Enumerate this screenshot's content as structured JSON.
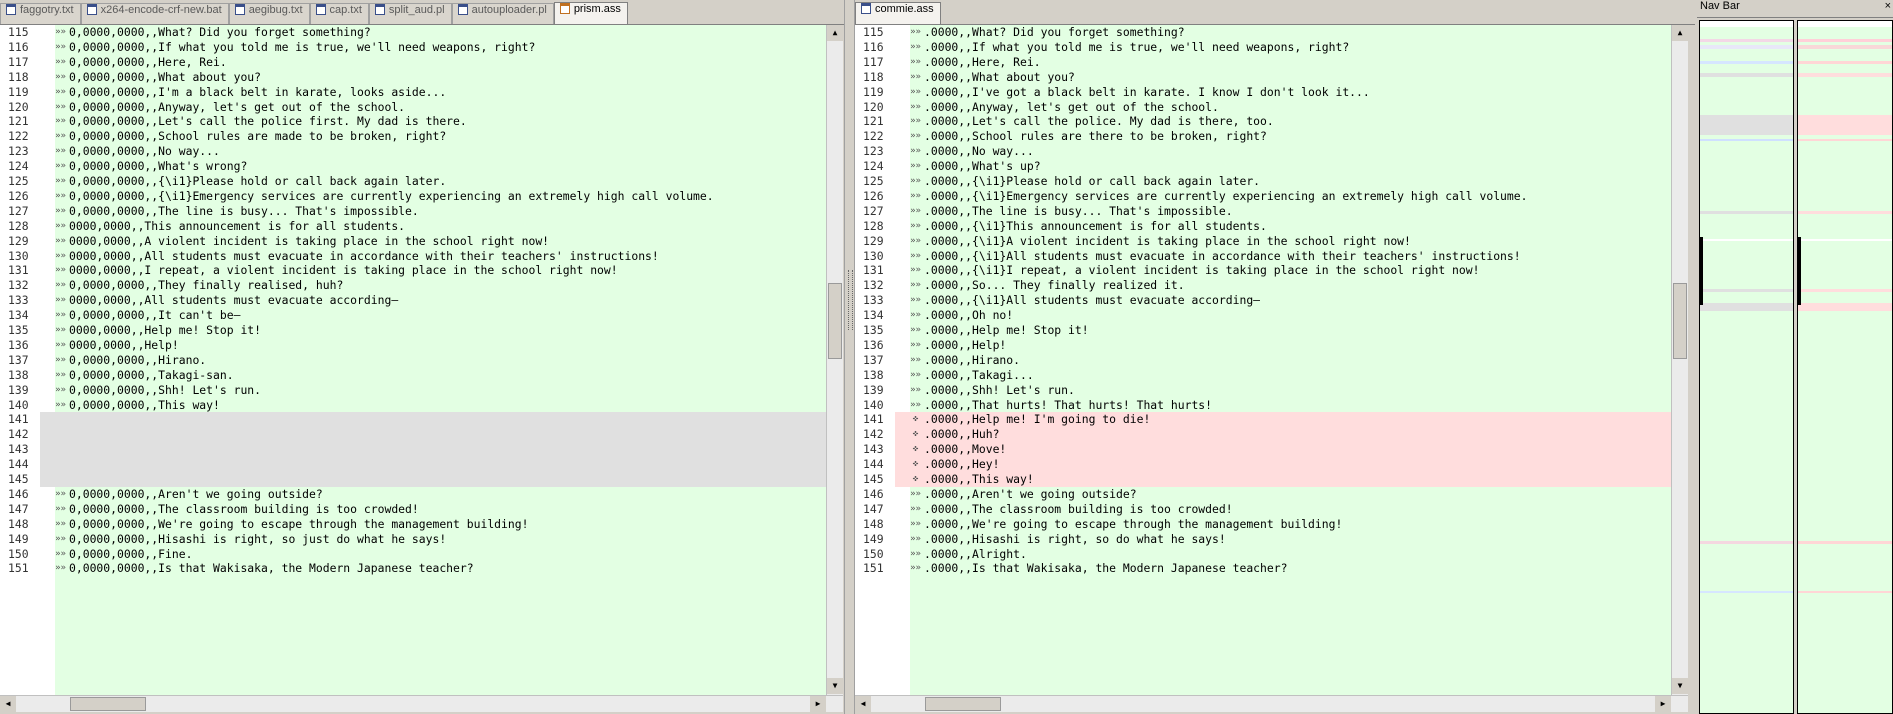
{
  "tabs_left": [
    {
      "label": "faggotry.txt",
      "active": false,
      "icon": "text-file-icon"
    },
    {
      "label": "x264-encode-crf-new.bat",
      "active": false,
      "icon": "text-file-icon"
    },
    {
      "label": "aegibug.txt",
      "active": false,
      "icon": "text-file-icon"
    },
    {
      "label": "cap.txt",
      "active": false,
      "icon": "text-file-icon"
    },
    {
      "label": "split_aud.pl",
      "active": false,
      "icon": "text-file-icon"
    },
    {
      "label": "autouploader.pl",
      "active": false,
      "icon": "text-file-icon"
    },
    {
      "label": "prism.ass",
      "active": true,
      "icon": "edited-file-icon"
    }
  ],
  "tabs_right": [
    {
      "label": "commie.ass",
      "active": true,
      "icon": "text-file-icon"
    }
  ],
  "navbar": {
    "title": "Nav Bar",
    "close": "×"
  },
  "scroll_glyphs": {
    "up": "▲",
    "down": "▼",
    "left": "◀",
    "right": "▶"
  },
  "colors": {
    "same": "#e3ffe3",
    "blank": "#e0e0e0",
    "added": "#ffdddd",
    "changed": "#c8dcc8"
  },
  "left_lines": [
    {
      "n": "115",
      "m": "»»",
      "t": "0,0000,0000,,What? Did you forget something?"
    },
    {
      "n": "116",
      "m": "»»",
      "t": "0,0000,0000,,If what you told me is true, we'll need weapons, right?"
    },
    {
      "n": "117",
      "m": "»»",
      "t": "0,0000,0000,,Here, Rei."
    },
    {
      "n": "118",
      "m": "»»",
      "t": "0,0000,0000,,What about you?"
    },
    {
      "n": "119",
      "m": "»»",
      "t": "0,0000,0000,,I'm a black belt in karate, looks aside..."
    },
    {
      "n": "120",
      "m": "»»",
      "t": "0,0000,0000,,Anyway, let's get out of the school."
    },
    {
      "n": "121",
      "m": "»»",
      "t": "0,0000,0000,,Let's call the police first. My dad is there."
    },
    {
      "n": "122",
      "m": "»»",
      "t": "0,0000,0000,,School rules are made to be broken, right?"
    },
    {
      "n": "123",
      "m": "»»",
      "t": "0,0000,0000,,No way..."
    },
    {
      "n": "124",
      "m": "»»",
      "t": "0,0000,0000,,What's wrong?"
    },
    {
      "n": "125",
      "m": "»»",
      "t": "0,0000,0000,,{\\i1}Please hold or call back again later."
    },
    {
      "n": "126",
      "m": "»»",
      "t": "0,0000,0000,,{\\i1}Emergency services are currently experiencing an extremely high call volume."
    },
    {
      "n": "127",
      "m": "»»",
      "t": "0,0000,0000,,The line is busy... That's impossible."
    },
    {
      "n": "128",
      "m": "»»",
      "t": "0000,0000,,This announcement is for all students."
    },
    {
      "n": "129",
      "m": "»»",
      "t": "0000,0000,,A violent incident is taking place in the school right now!"
    },
    {
      "n": "130",
      "m": "»»",
      "t": "0000,0000,,All students must evacuate in accordance with their teachers' instructions!"
    },
    {
      "n": "131",
      "m": "»»",
      "t": "0000,0000,,I repeat, a violent incident is taking place in the school right now!"
    },
    {
      "n": "132",
      "m": "»»",
      "t": "0,0000,0000,,They finally realised, huh?"
    },
    {
      "n": "133",
      "m": "»»",
      "t": "0000,0000,,All students must evacuate according—"
    },
    {
      "n": "134",
      "m": "»»",
      "t": "0,0000,0000,,It can't be—"
    },
    {
      "n": "135",
      "m": "»»",
      "t": "0000,0000,,Help me! Stop it!"
    },
    {
      "n": "136",
      "m": "»»",
      "t": "0000,0000,,Help!"
    },
    {
      "n": "137",
      "m": "»»",
      "t": "0,0000,0000,,Hirano."
    },
    {
      "n": "138",
      "m": "»»",
      "t": "0,0000,0000,,Takagi-san."
    },
    {
      "n": "139",
      "m": "»»",
      "t": "0,0000,0000,,Shh! Let's run."
    },
    {
      "n": "140",
      "m": "»»",
      "t": "0,0000,0000,,This way!"
    },
    {
      "n": "141",
      "m": "",
      "t": "",
      "kind": "blank"
    },
    {
      "n": "142",
      "m": "",
      "t": "",
      "kind": "blank"
    },
    {
      "n": "143",
      "m": "",
      "t": "",
      "kind": "blank"
    },
    {
      "n": "144",
      "m": "",
      "t": "",
      "kind": "blank"
    },
    {
      "n": "145",
      "m": "",
      "t": "",
      "kind": "blank"
    },
    {
      "n": "146",
      "m": "»»",
      "t": "0,0000,0000,,Aren't we going outside?"
    },
    {
      "n": "147",
      "m": "»»",
      "t": "0,0000,0000,,The classroom building is too crowded!"
    },
    {
      "n": "148",
      "m": "»»",
      "t": "0,0000,0000,,We're going to escape through the management building!"
    },
    {
      "n": "149",
      "m": "»»",
      "t": "0,0000,0000,,Hisashi is right, so just do what he says!"
    },
    {
      "n": "150",
      "m": "»»",
      "t": "0,0000,0000,,Fine."
    },
    {
      "n": "151",
      "m": "»»",
      "t": "0,0000,0000,,Is that Wakisaka, the Modern Japanese teacher?"
    }
  ],
  "right_lines": [
    {
      "n": "115",
      "m": "»»",
      "t": ".0000,,What? Did you forget something?"
    },
    {
      "n": "116",
      "m": "»»",
      "t": ".0000,,If what you told me is true, we'll need weapons, right?"
    },
    {
      "n": "117",
      "m": "»»",
      "t": ".0000,,Here, Rei."
    },
    {
      "n": "118",
      "m": "»»",
      "t": ".0000,,What about you?"
    },
    {
      "n": "119",
      "m": "»»",
      "t": ".0000,,I've got a black belt in karate. I know I don't look it..."
    },
    {
      "n": "120",
      "m": "»»",
      "t": ".0000,,Anyway, let's get out of the school."
    },
    {
      "n": "121",
      "m": "»»",
      "t": ".0000,,Let's call the police. My dad is there, too."
    },
    {
      "n": "122",
      "m": "»»",
      "t": ".0000,,School rules are there to be broken, right?"
    },
    {
      "n": "123",
      "m": "»»",
      "t": ".0000,,No way..."
    },
    {
      "n": "124",
      "m": "»»",
      "t": ".0000,,What's up?"
    },
    {
      "n": "125",
      "m": "»»",
      "t": ".0000,,{\\i1}Please hold or call back again later."
    },
    {
      "n": "126",
      "m": "»»",
      "t": ".0000,,{\\i1}Emergency services are currently experiencing an extremely high call volume."
    },
    {
      "n": "127",
      "m": "»»",
      "t": ".0000,,The line is busy... That's impossible."
    },
    {
      "n": "128",
      "m": "»»",
      "t": ".0000,,{\\i1}This announcement is for all students."
    },
    {
      "n": "129",
      "m": "»»",
      "t": ".0000,,{\\i1}A violent incident is taking place in the school right now!"
    },
    {
      "n": "130",
      "m": "»»",
      "t": ".0000,,{\\i1}All students must evacuate in accordance with their teachers' instructions!"
    },
    {
      "n": "131",
      "m": "»»",
      "t": ".0000,,{\\i1}I repeat, a violent incident is taking place in the school right now!"
    },
    {
      "n": "132",
      "m": "»»",
      "t": ".0000,,So... They finally realized it."
    },
    {
      "n": "133",
      "m": "»»",
      "t": ".0000,,{\\i1}All students must evacuate according—"
    },
    {
      "n": "134",
      "m": "»»",
      "t": ".0000,,Oh no!"
    },
    {
      "n": "135",
      "m": "»»",
      "t": ".0000,,Help me! Stop it!"
    },
    {
      "n": "136",
      "m": "»»",
      "t": ".0000,,Help!"
    },
    {
      "n": "137",
      "m": "»»",
      "t": ".0000,,Hirano."
    },
    {
      "n": "138",
      "m": "»»",
      "t": ".0000,,Takagi..."
    },
    {
      "n": "139",
      "m": "»»",
      "t": ".0000,,Shh! Let's run."
    },
    {
      "n": "140",
      "m": "»»",
      "t": ".0000,,That hurts! That hurts! That hurts!"
    },
    {
      "n": "141",
      "m": "✜",
      "t": ".0000,,Help me! I'm going to die!",
      "kind": "add"
    },
    {
      "n": "142",
      "m": "✜",
      "t": ".0000,,Huh?",
      "kind": "add"
    },
    {
      "n": "143",
      "m": "✜",
      "t": ".0000,,Move!",
      "kind": "add"
    },
    {
      "n": "144",
      "m": "✜",
      "t": ".0000,,Hey!",
      "kind": "add"
    },
    {
      "n": "145",
      "m": "✜",
      "t": ".0000,,This way!",
      "kind": "add"
    },
    {
      "n": "146",
      "m": "»»",
      "t": ".0000,,Aren't we going outside?"
    },
    {
      "n": "147",
      "m": "»»",
      "t": ".0000,,The classroom building is too crowded!"
    },
    {
      "n": "148",
      "m": "»»",
      "t": ".0000,,We're going to escape through the management building!"
    },
    {
      "n": "149",
      "m": "»»",
      "t": ".0000,,Hisashi is right, so do what he says!"
    },
    {
      "n": "150",
      "m": "»»",
      "t": ".0000,,Alright."
    },
    {
      "n": "151",
      "m": "»»",
      "t": ".0000,,Is that Wakisaka, the Modern Japanese teacher?"
    }
  ]
}
